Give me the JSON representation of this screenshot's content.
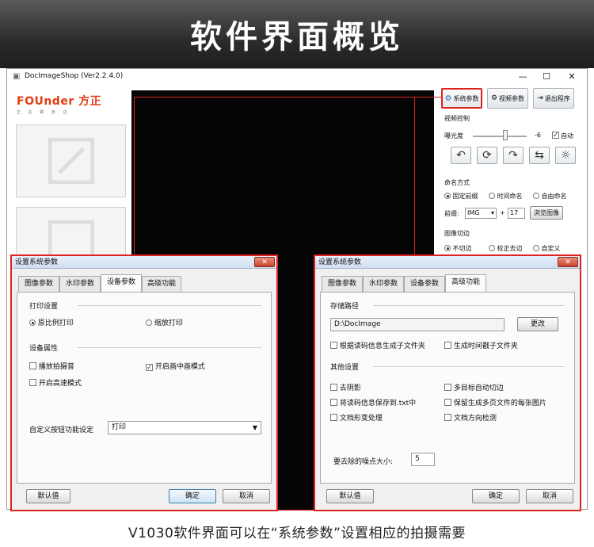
{
  "banner": {
    "title": "软件界面概览"
  },
  "app": {
    "title": "DocImageShop (Ver2.2.4.0)",
    "window_controls": {
      "minimize": "—",
      "maximize": "☐",
      "close": "✕"
    },
    "logo": "FOUnder 方正",
    "logo_sub": "正 在 做 身 边",
    "top_buttons": {
      "system": "系统参数",
      "video": "视频参数",
      "exit": "退出程序"
    },
    "video_section": "视频控制",
    "exposure_label": "曝光度",
    "exposure_value": "-6",
    "auto_label": "自动",
    "naming_section": "命名方式",
    "naming_options": [
      "固定前缀",
      "时间命名",
      "自由命名"
    ],
    "prefix_label": "前缀:",
    "prefix_value": "IMG",
    "plus": "+",
    "counter_value": "17",
    "browse_button": "浏览图像",
    "crop_section": "图像切边",
    "crop_options": [
      "不切边",
      "校正去边",
      "自定义"
    ]
  },
  "dialog_left": {
    "title": "设置系统参数",
    "tabs": [
      "图像参数",
      "水印参数",
      "设备参数",
      "高级功能"
    ],
    "active_tab": 2,
    "print_group": "打印设置",
    "print_options": [
      "原比例打印",
      "缩放打印"
    ],
    "device_group": "设备属性",
    "device_options": [
      "播放拍摄音",
      "开启画中画模式",
      "开启高速模式"
    ],
    "custom_button_label": "自定义按钮功能设定",
    "custom_button_value": "打印",
    "buttons": {
      "default": "默认值",
      "ok": "确定",
      "cancel": "取消"
    }
  },
  "dialog_right": {
    "title": "设置系统参数",
    "tabs": [
      "图像参数",
      "水印参数",
      "设备参数",
      "高级功能"
    ],
    "active_tab": 3,
    "storage_group": "存储路径",
    "path_value": "D:\\DocImage",
    "change_button": "更改",
    "storage_options": [
      "根据读码信息生成子文件夹",
      "生成时间戳子文件夹"
    ],
    "other_group": "其他设置",
    "other_options": [
      "去阴影",
      "多目标自动切边",
      "将读码信息保存到.txt中",
      "保留生成多页文件的每张图片",
      "文档形变处理",
      "文档方向检测"
    ],
    "noise_label": "要去除的噪点大小:",
    "noise_value": "5",
    "buttons": {
      "default": "默认值",
      "ok": "确定",
      "cancel": "取消"
    }
  },
  "caption": "V1030软件界面可以在“系统参数”设置相应的拍摄需要"
}
